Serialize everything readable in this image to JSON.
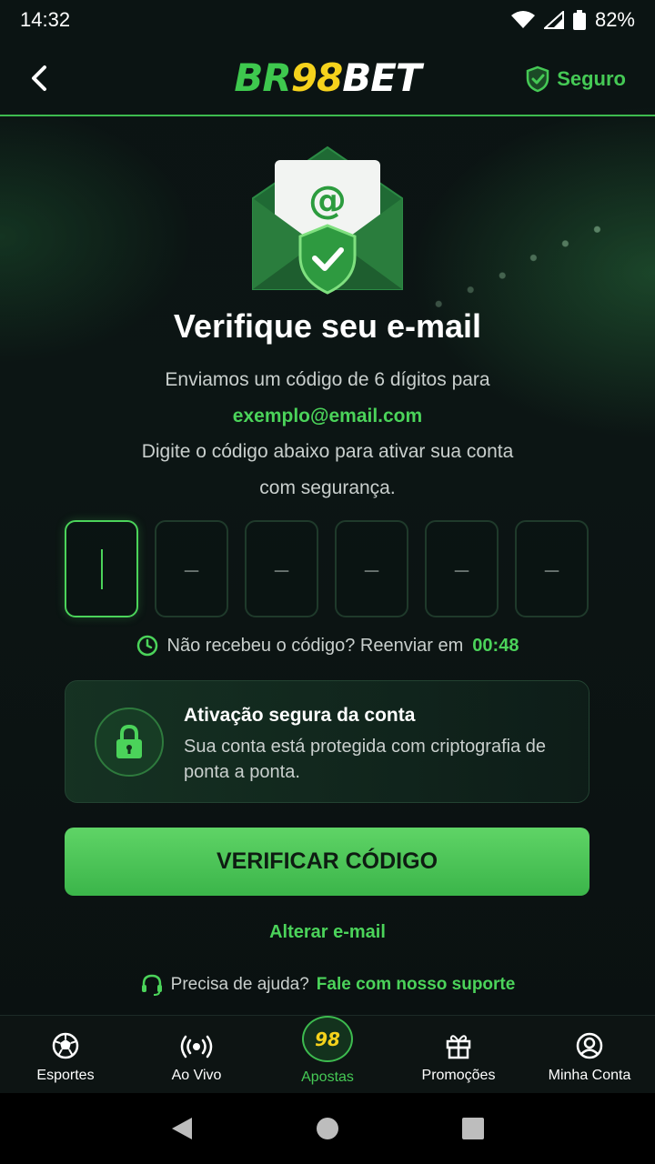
{
  "status_bar": {
    "time": "14:32",
    "battery": "82%"
  },
  "header": {
    "logo": {
      "part1": "BR",
      "part2": "98",
      "part3": "BET"
    },
    "secure_label": "Seguro"
  },
  "verification": {
    "title": "Verifique seu e-mail",
    "line1": "Enviamos um código de 6 dígitos para",
    "email": "exemplo@email.com",
    "line2": "Digite o código abaixo para ativar sua conta",
    "line3": "com segurança.",
    "code_placeholder": "–",
    "resend_text": "Não recebeu o código? Reenviar em",
    "resend_timer": "00:48"
  },
  "info_card": {
    "title": "Ativação segura da conta",
    "text": "Sua conta está protegida com criptografia de ponta a ponta."
  },
  "actions": {
    "verify_label": "VERIFICAR CÓDIGO",
    "change_email_label": "Alterar e-mail",
    "help_text": "Precisa de ajuda?",
    "help_link": "Fale com nosso suporte"
  },
  "bottom_nav": {
    "items": [
      {
        "label": "Esportes",
        "icon": "soccer-ball-icon"
      },
      {
        "label": "Ao Vivo",
        "icon": "live-broadcast-icon"
      },
      {
        "label": "Apostas",
        "icon": "bets-98-badge",
        "badge": "98"
      },
      {
        "label": "Promoções",
        "icon": "gift-icon"
      },
      {
        "label": "Minha Conta",
        "icon": "account-icon"
      }
    ]
  },
  "colors": {
    "accent": "#3ec84e",
    "brand_yellow": "#f5d21c",
    "background": "#0b1112"
  }
}
